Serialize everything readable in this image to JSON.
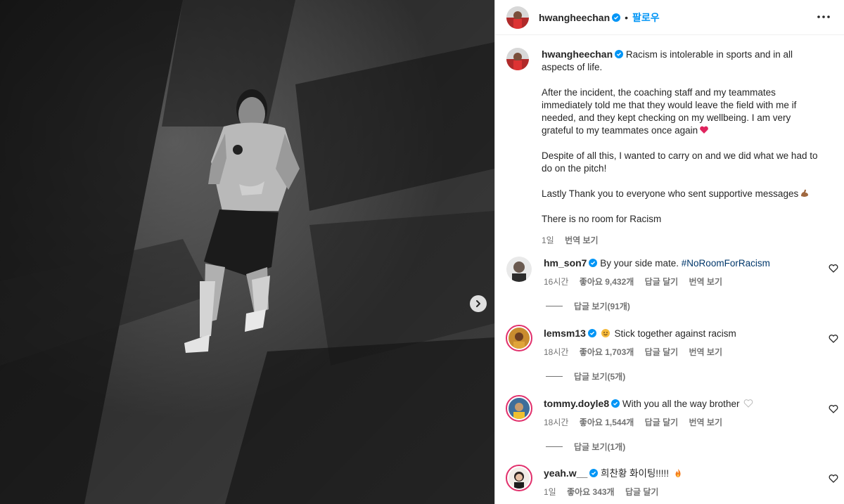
{
  "post": {
    "username": "hwangheechan",
    "follow_label": "팔로우",
    "dot": "•",
    "caption": {
      "paragraphs": [
        "Racism is intolerable in sports and in all aspects of life.",
        "After the incident, the coaching staff and my teammates immediately told me that they would leave the field with me if needed, and they kept checking on my wellbeing. I am very grateful to my teammates once again",
        "Despite of all this, I wanted to carry on and we did what we had to do on the pitch!",
        "Lastly Thank you to everyone who sent supportive messages",
        "There is no room for Racism"
      ],
      "time": "1일",
      "translate": "번역 보기"
    }
  },
  "comments": [
    {
      "username": "hm_son7",
      "text": "By your side mate. ",
      "hashtag": "#NoRoomForRacism",
      "time": "16시간",
      "likes": "좋아요 9,432개",
      "reply": "답글 달기",
      "translate": "번역 보기",
      "replies": "답글 보기(91개)"
    },
    {
      "username": "lemsm13",
      "text": "Stick together against racism",
      "time": "18시간",
      "likes": "좋아요 1,703개",
      "reply": "답글 달기",
      "translate": "번역 보기",
      "replies": "답글 보기(5개)"
    },
    {
      "username": "tommy.doyle8",
      "text": "With you all the way brother",
      "time": "18시간",
      "likes": "좋아요 1,544개",
      "reply": "답글 달기",
      "translate": "번역 보기",
      "replies": "답글 보기(1개)"
    },
    {
      "username": "yeah.w__",
      "text": "희찬황 화이팅!!!!!",
      "time": "1일",
      "likes": "좋아요 343개",
      "reply": "답글 달기"
    }
  ],
  "colors": {
    "accent": "#0095f6",
    "verified": "#0095f6",
    "story_ring": "#e1306c",
    "muted": "#737373",
    "hashtag": "#00376b"
  },
  "icons": {
    "next": "chevron-right-icon",
    "more": "more-horizontal-icon",
    "like": "heart-outline-icon",
    "verified": "verified-badge-icon"
  }
}
